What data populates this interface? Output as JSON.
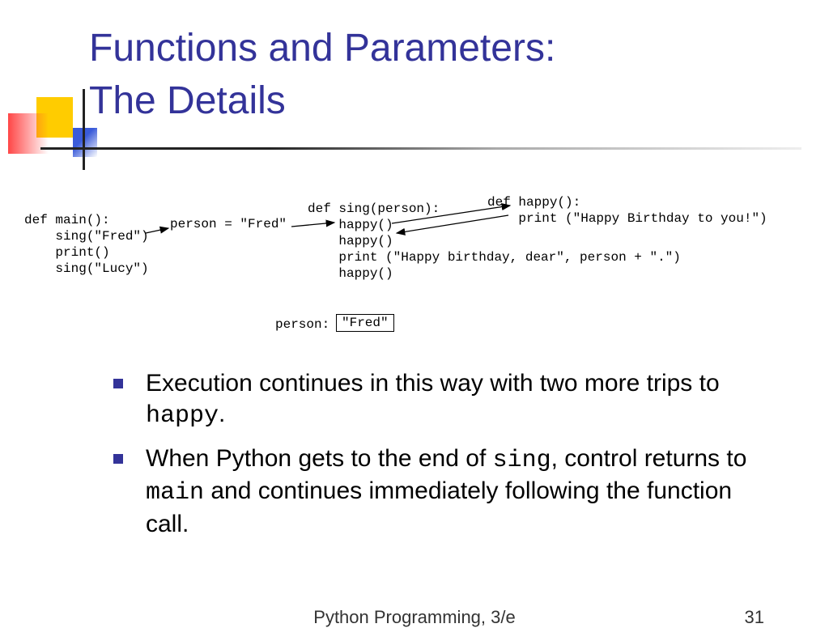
{
  "title": {
    "line1": "Functions and Parameters:",
    "line2": "The Details"
  },
  "diagram": {
    "main_code": "def main():\n    sing(\"Fred\")\n    print()\n    sing(\"Lucy\")",
    "assign_label": "person = \"Fred\"",
    "sing_code": "def sing(person):\n    happy()\n    happy()\n    print (\"Happy birthday, dear\", person + \".\")\n    happy()",
    "happy_code": "def happy():\n    print (\"Happy Birthday to you!\")",
    "var_label": "person:",
    "var_value": "\"Fred\""
  },
  "bullets": [
    {
      "pre": "Execution continues in this way with two more trips to ",
      "code": "happy",
      "post": "."
    },
    {
      "pre": "When Python gets to the end of ",
      "code": "sing",
      "mid": ", control returns to ",
      "code2": "main",
      "post": " and continues immediately following the function call."
    }
  ],
  "footer": {
    "text": "Python Programming, 3/e",
    "page": "31"
  }
}
